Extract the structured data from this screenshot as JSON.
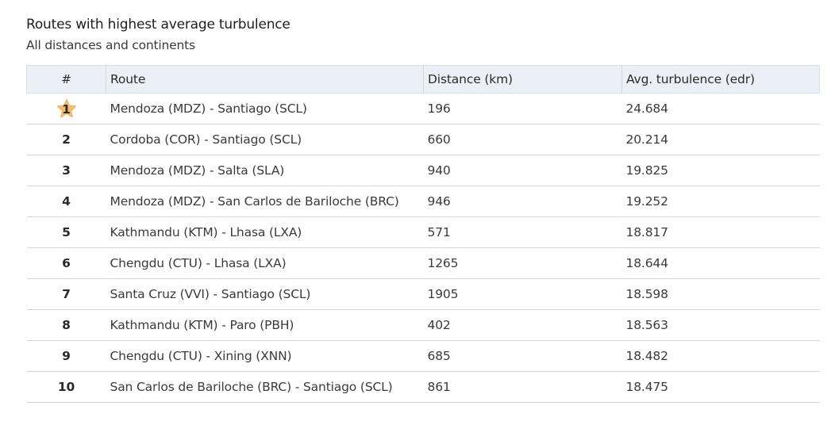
{
  "title": "Routes with highest average turbulence",
  "subtitle": "All distances and continents",
  "table": {
    "headers": {
      "rank": "#",
      "route": "Route",
      "distance": "Distance (km)",
      "turbulence": "Avg. turbulence (edr)"
    },
    "rows": [
      {
        "rank": "1",
        "route": "Mendoza (MDZ) - Santiago (SCL)",
        "distance": "196",
        "turbulence": "24.684",
        "highlight": true
      },
      {
        "rank": "2",
        "route": "Cordoba (COR) - Santiago (SCL)",
        "distance": "660",
        "turbulence": "20.214"
      },
      {
        "rank": "3",
        "route": "Mendoza (MDZ) - Salta (SLA)",
        "distance": "940",
        "turbulence": "19.825"
      },
      {
        "rank": "4",
        "route": "Mendoza (MDZ) - San Carlos de Bariloche (BRC)",
        "distance": "946",
        "turbulence": "19.252"
      },
      {
        "rank": "5",
        "route": "Kathmandu (KTM) - Lhasa (LXA)",
        "distance": "571",
        "turbulence": "18.817"
      },
      {
        "rank": "6",
        "route": "Chengdu (CTU) - Lhasa (LXA)",
        "distance": "1265",
        "turbulence": "18.644"
      },
      {
        "rank": "7",
        "route": "Santa Cruz (VVI) - Santiago (SCL)",
        "distance": "1905",
        "turbulence": "18.598"
      },
      {
        "rank": "8",
        "route": "Kathmandu (KTM) - Paro (PBH)",
        "distance": "402",
        "turbulence": "18.563"
      },
      {
        "rank": "9",
        "route": "Chengdu (CTU) - Xining (XNN)",
        "distance": "685",
        "turbulence": "18.482"
      },
      {
        "rank": "10",
        "route": "San Carlos de Bariloche (BRC) - Santiago (SCL)",
        "distance": "861",
        "turbulence": "18.475"
      }
    ]
  },
  "icons": {
    "top_rank": "star-icon"
  },
  "colors": {
    "header_bg": "#ebf0f6",
    "star_fill": "#f6bb6b",
    "row_border": "#d4d4d4"
  }
}
